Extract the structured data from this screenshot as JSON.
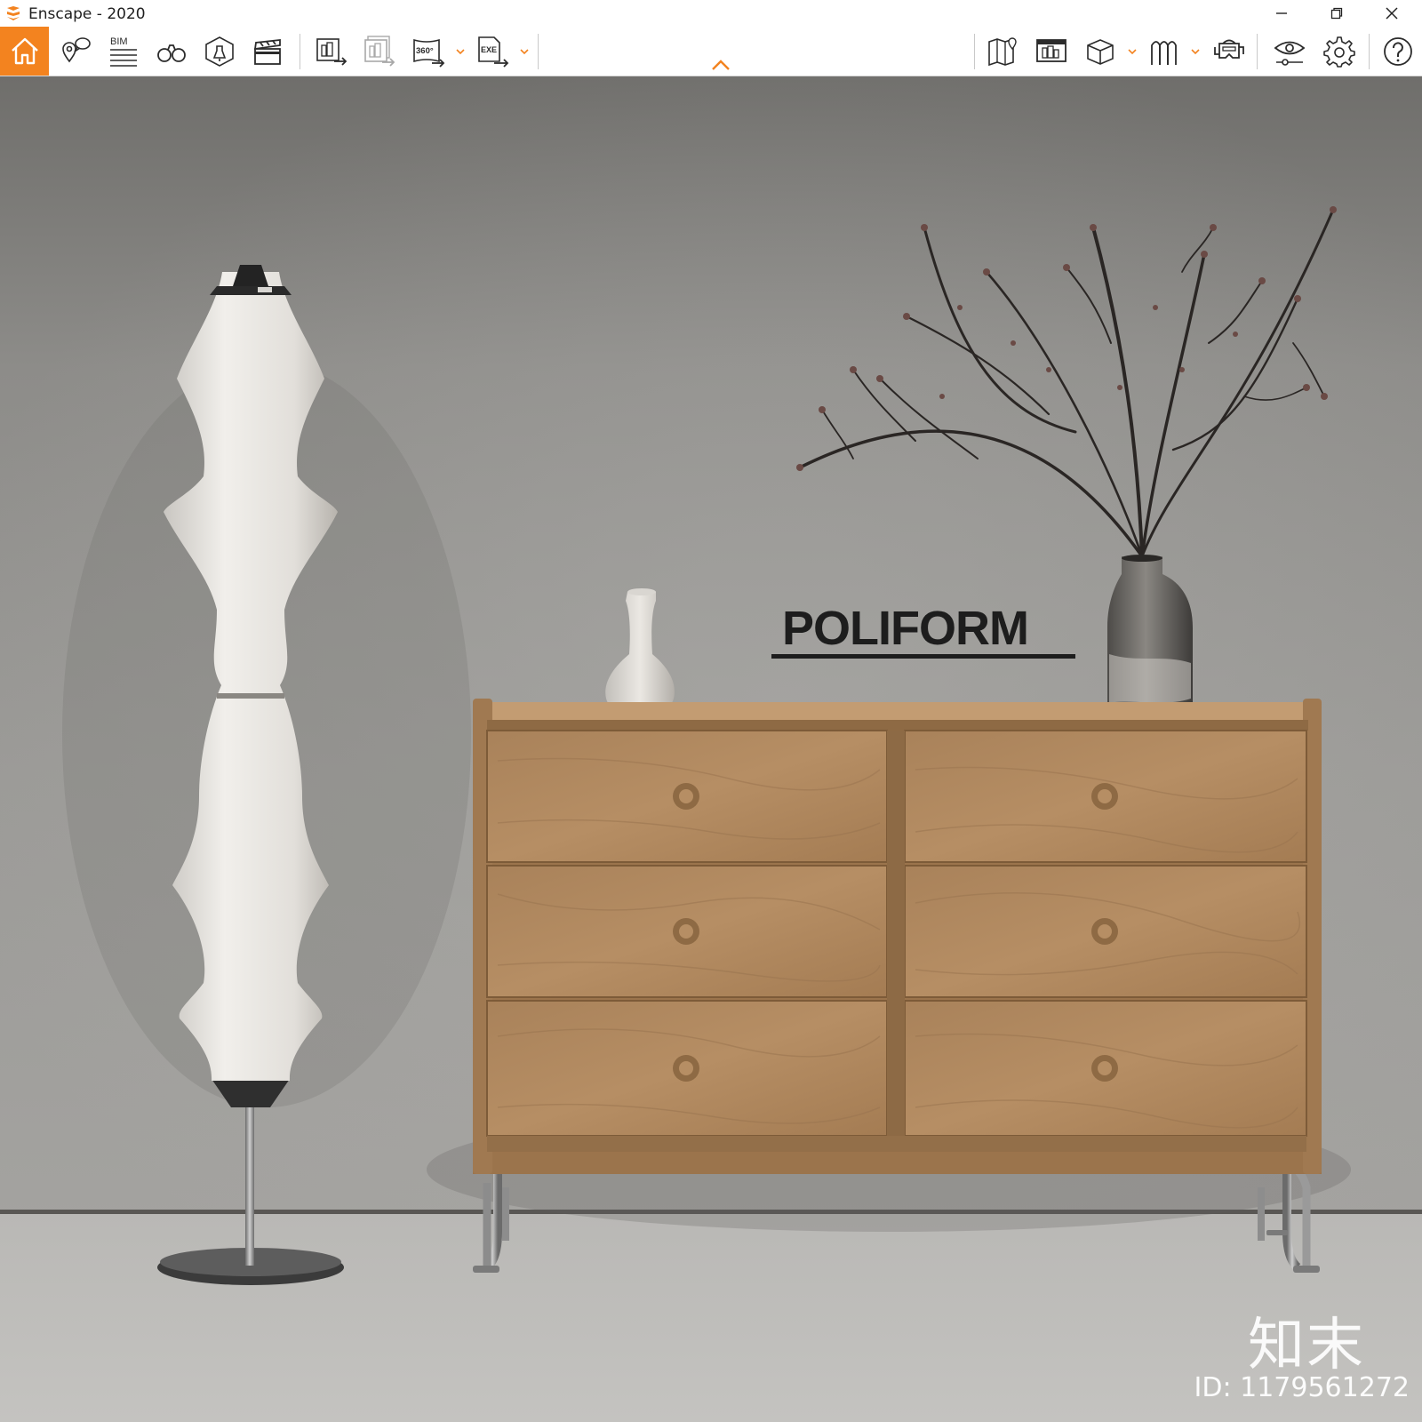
{
  "window": {
    "title": "Enscape - 2020",
    "controls": [
      "minimize",
      "restore",
      "close"
    ]
  },
  "toolbar": {
    "accent_color": "#f3831f",
    "left_icons": [
      "home-icon",
      "location-pin-icon",
      "bim-icon",
      "binoculars-icon",
      "light-view-icon",
      "clapperboard-icon"
    ],
    "export_icons": [
      "export-screenshot-icon",
      "batch-export-icon",
      "panorama-360-icon",
      "exe-export-icon"
    ],
    "right_icons": [
      "map-icon",
      "asset-library-icon",
      "cube-icon",
      "material-icon",
      "vr-headset-icon",
      "visual-settings-icon",
      "gear-icon",
      "help-icon"
    ],
    "bim_label": "BIM",
    "pano_label": "360°",
    "exe_label": "EXE"
  },
  "scene": {
    "brand_text": "POLIFORM",
    "watermark_logo": "知末",
    "watermark_id": "ID: 1179561272"
  }
}
